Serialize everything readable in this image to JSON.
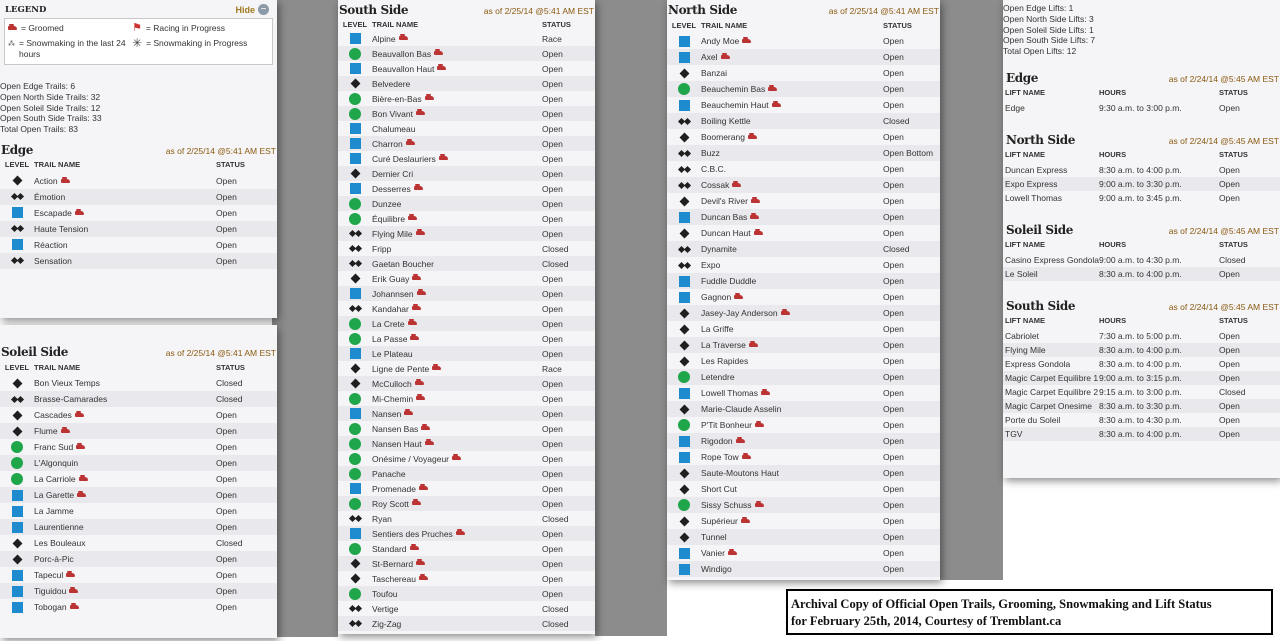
{
  "legend": {
    "title": "LEGEND",
    "hide": "Hide",
    "groomed": "= Groomed",
    "racing": "= Racing in Progress",
    "snowmaking24": "= Snowmaking in the last 24 hours",
    "snowmaking_progress": "= Snowmaking in Progress"
  },
  "totals": [
    "Open Edge Trails: 6",
    "Open North Side Trails: 32",
    "Open Soleil Side Trails: 12",
    "Open South Side Trails: 33",
    "Total Open Trails: 83"
  ],
  "trail_cols": {
    "level": "LEVEL",
    "name": "TRAIL NAME",
    "status": "STATUS"
  },
  "lift_cols": {
    "name": "LIFT NAME",
    "hours": "HOURS",
    "status": "STATUS"
  },
  "edge": {
    "title": "Edge",
    "asof": "as of 2/25/14 @5:41 AM EST",
    "rows": [
      [
        "dia",
        "Action",
        1,
        "Open"
      ],
      [
        "dd",
        "Émotion",
        0,
        "Open"
      ],
      [
        "sq",
        "Escapade",
        1,
        "Open"
      ],
      [
        "dd",
        "Haute Tension",
        0,
        "Open"
      ],
      [
        "sq",
        "Réaction",
        0,
        "Open"
      ],
      [
        "dd",
        "Sensation",
        0,
        "Open"
      ]
    ]
  },
  "soleil": {
    "title": "Soleil Side",
    "asof": "as of 2/25/14 @5:41 AM EST",
    "rows": [
      [
        "dia",
        "Bon Vieux Temps",
        0,
        "Closed"
      ],
      [
        "dd",
        "Brasse-Camarades",
        0,
        "Closed"
      ],
      [
        "dia",
        "Cascades",
        1,
        "Open"
      ],
      [
        "dia",
        "Flume",
        1,
        "Open"
      ],
      [
        "ci",
        "Franc Sud",
        1,
        "Open"
      ],
      [
        "ci",
        "L'Algonquin",
        0,
        "Open"
      ],
      [
        "ci",
        "La Carriole",
        1,
        "Open"
      ],
      [
        "sq",
        "La Garette",
        1,
        "Open"
      ],
      [
        "sq",
        "La Jamme",
        0,
        "Open"
      ],
      [
        "sq",
        "Laurentienne",
        0,
        "Open"
      ],
      [
        "dia",
        "Les Bouleaux",
        0,
        "Closed"
      ],
      [
        "dia",
        "Porc-à-Pic",
        0,
        "Open"
      ],
      [
        "sq",
        "Tapecul",
        1,
        "Open"
      ],
      [
        "sq",
        "Tiguidou",
        1,
        "Open"
      ],
      [
        "sq",
        "Tobogan",
        1,
        "Open"
      ]
    ]
  },
  "south": {
    "title": "South Side",
    "asof": "as of 2/25/14 @5:41 AM EST",
    "rows": [
      [
        "sq",
        "Alpine",
        1,
        "Race"
      ],
      [
        "ci",
        "Beauvallon Bas",
        1,
        "Open"
      ],
      [
        "sq",
        "Beauvallon Haut",
        1,
        "Open"
      ],
      [
        "dia",
        "Belvedere",
        0,
        "Open"
      ],
      [
        "ci",
        "Bière-en-Bas",
        1,
        "Open"
      ],
      [
        "ci",
        "Bon Vivant",
        1,
        "Open"
      ],
      [
        "sq",
        "Chalumeau",
        0,
        "Open"
      ],
      [
        "sq",
        "Charron",
        1,
        "Open"
      ],
      [
        "sq",
        "Curé Deslauriers",
        1,
        "Open"
      ],
      [
        "dia",
        "Dernier Cri",
        0,
        "Open"
      ],
      [
        "sq",
        "Desserres",
        1,
        "Open"
      ],
      [
        "ci",
        "Dunzee",
        0,
        "Open"
      ],
      [
        "ci",
        "Équilibre",
        1,
        "Open"
      ],
      [
        "dd",
        "Flying Mile",
        1,
        "Open"
      ],
      [
        "dd",
        "Fripp",
        0,
        "Closed"
      ],
      [
        "dd",
        "Gaetan Boucher",
        0,
        "Closed"
      ],
      [
        "dia",
        "Erik Guay",
        1,
        "Open"
      ],
      [
        "sq",
        "Johannsen",
        1,
        "Open"
      ],
      [
        "dd",
        "Kandahar",
        1,
        "Open"
      ],
      [
        "ci",
        "La Crete",
        1,
        "Open"
      ],
      [
        "ci",
        "La Passe",
        1,
        "Open"
      ],
      [
        "sq",
        "Le Plateau",
        0,
        "Open"
      ],
      [
        "dia",
        "Ligne de Pente",
        1,
        "Race"
      ],
      [
        "dia",
        "McCulloch",
        1,
        "Open"
      ],
      [
        "ci",
        "Mi-Chemin",
        1,
        "Open"
      ],
      [
        "sq",
        "Nansen",
        1,
        "Open"
      ],
      [
        "ci",
        "Nansen Bas",
        1,
        "Open"
      ],
      [
        "ci",
        "Nansen Haut",
        1,
        "Open"
      ],
      [
        "ci",
        "Onésime / Voyageur",
        1,
        "Open"
      ],
      [
        "ci",
        "Panache",
        0,
        "Open"
      ],
      [
        "sq",
        "Promenade",
        1,
        "Open"
      ],
      [
        "ci",
        "Roy Scott",
        1,
        "Open"
      ],
      [
        "dd",
        "Ryan",
        0,
        "Closed"
      ],
      [
        "sq",
        "Sentiers des Pruches",
        1,
        "Open"
      ],
      [
        "ci",
        "Standard",
        1,
        "Open"
      ],
      [
        "dia",
        "St-Bernard",
        1,
        "Open"
      ],
      [
        "dia",
        "Taschereau",
        1,
        "Open"
      ],
      [
        "ci",
        "Toufou",
        0,
        "Open"
      ],
      [
        "dd",
        "Vertige",
        0,
        "Closed"
      ],
      [
        "dd",
        "Zig-Zag",
        0,
        "Closed"
      ]
    ]
  },
  "north": {
    "title": "North Side",
    "asof": "as of 2/25/14 @5:41 AM EST",
    "rows": [
      [
        "sq",
        "Andy Moe",
        1,
        "Open"
      ],
      [
        "sq",
        "Axel",
        1,
        "Open"
      ],
      [
        "dia",
        "Banzai",
        0,
        "Open"
      ],
      [
        "ci",
        "Beauchemin Bas",
        1,
        "Open"
      ],
      [
        "sq",
        "Beauchemin Haut",
        1,
        "Open"
      ],
      [
        "dd",
        "Boiling Kettle",
        0,
        "Closed"
      ],
      [
        "dia",
        "Boomerang",
        1,
        "Open"
      ],
      [
        "dd",
        "Buzz",
        0,
        "Open Bottom"
      ],
      [
        "dd",
        "C.B.C.",
        0,
        "Open"
      ],
      [
        "dd",
        "Cossak",
        1,
        "Open"
      ],
      [
        "dia",
        "Devil's River",
        1,
        "Open"
      ],
      [
        "sq",
        "Duncan Bas",
        1,
        "Open"
      ],
      [
        "dia",
        "Duncan Haut",
        1,
        "Open"
      ],
      [
        "dd",
        "Dynamite",
        0,
        "Closed"
      ],
      [
        "dd",
        "Expo",
        0,
        "Open"
      ],
      [
        "sq",
        "Fuddle Duddle",
        0,
        "Open"
      ],
      [
        "sq",
        "Gagnon",
        1,
        "Open"
      ],
      [
        "dia",
        "Jasey-Jay Anderson",
        1,
        "Open"
      ],
      [
        "dia",
        "La Griffe",
        0,
        "Open"
      ],
      [
        "dia",
        "La Traverse",
        1,
        "Open"
      ],
      [
        "dia",
        "Les Rapides",
        0,
        "Open"
      ],
      [
        "ci",
        "Letendre",
        0,
        "Open"
      ],
      [
        "sq",
        "Lowell Thomas",
        1,
        "Open"
      ],
      [
        "dia",
        "Marie-Claude Asselin",
        0,
        "Open"
      ],
      [
        "ci",
        "P'Tit Bonheur",
        1,
        "Open"
      ],
      [
        "sq",
        "Rigodon",
        1,
        "Open"
      ],
      [
        "sq",
        "Rope Tow",
        1,
        "Open"
      ],
      [
        "dia",
        "Saute-Moutons Haut",
        0,
        "Open"
      ],
      [
        "dia",
        "Short Cut",
        0,
        "Open"
      ],
      [
        "ci",
        "Sissy Schuss",
        1,
        "Open"
      ],
      [
        "dia",
        "Supérieur",
        1,
        "Open"
      ],
      [
        "dia",
        "Tunnel",
        0,
        "Open"
      ],
      [
        "sq",
        "Vanier",
        1,
        "Open"
      ],
      [
        "sq",
        "Windigo",
        0,
        "Open"
      ]
    ]
  },
  "lifts": {
    "totals": [
      "Open Edge Lifts: 1",
      "Open North Side Lifts: 3",
      "Open Soleil Side Lifts: 1",
      "Open South Side Lifts: 7",
      "Total Open Lifts: 12"
    ],
    "sections": [
      {
        "title": "Edge",
        "asof": "as of 2/24/14 @5:45 AM EST",
        "rows": [
          [
            "Edge",
            "9:30 a.m. to 3:00 p.m.",
            "Open"
          ]
        ]
      },
      {
        "title": "North Side",
        "asof": "as of 2/24/14 @5:45 AM EST",
        "rows": [
          [
            "Duncan Express",
            "8:30 a.m. to 4:00 p.m.",
            "Open"
          ],
          [
            "Expo Express",
            "9:00 a.m. to 3:30 p.m.",
            "Open"
          ],
          [
            "Lowell Thomas",
            "9:00 a.m. to 3:45 p.m.",
            "Open"
          ]
        ]
      },
      {
        "title": "Soleil Side",
        "asof": "as of 2/24/14 @5:45 AM EST",
        "rows": [
          [
            "Casino Express Gondola",
            "9:00 a.m. to 4:30 p.m.",
            "Closed"
          ],
          [
            "Le Soleil",
            "8:30 a.m. to 4:00 p.m.",
            "Open"
          ]
        ]
      },
      {
        "title": "South Side",
        "asof": "as of 2/24/14 @5:45 AM EST",
        "rows": [
          [
            "Cabriolet",
            "7:30 a.m. to 5:00 p.m.",
            "Open"
          ],
          [
            "Flying Mile",
            "8:30 a.m. to 4:00 p.m.",
            "Open"
          ],
          [
            "Express Gondola",
            "8:30 a.m. to 4:00 p.m.",
            "Open"
          ],
          [
            "Magic Carpet Equilibre 1",
            "9:00 a.m. to 3:15 p.m.",
            "Open"
          ],
          [
            "Magic Carpet Equilibre 2",
            "9:15 a.m. to 3:00 p.m.",
            "Closed"
          ],
          [
            "Magic Carpet Onesime",
            "8:30 a.m. to 3:30 p.m.",
            "Open"
          ],
          [
            "Porte du Soleil",
            "8:30 a.m. to 4:30 p.m.",
            "Open"
          ],
          [
            "TGV",
            "8:30 a.m. to 4:00 p.m.",
            "Open"
          ]
        ]
      }
    ]
  },
  "caption": {
    "line1": "Archival Copy of Official Open Trails, Grooming, Snowmaking and Lift Status",
    "line2": "for February 25th, 2014, Courtesy of Tremblant.ca"
  }
}
